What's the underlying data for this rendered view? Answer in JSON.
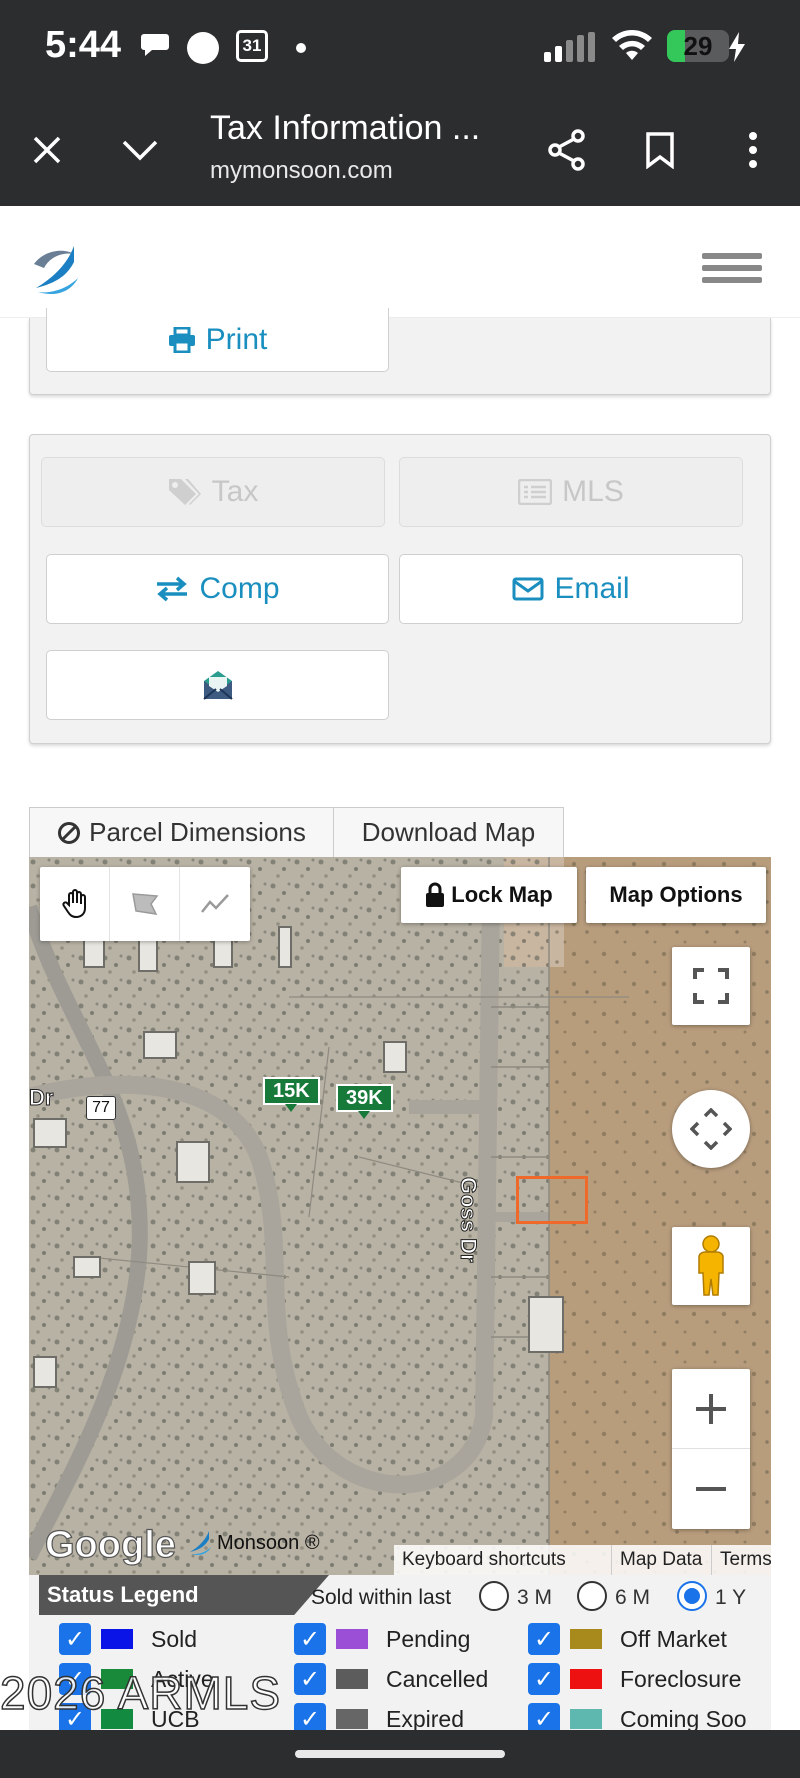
{
  "status_bar": {
    "time": "5:44",
    "calendar_day": "31",
    "battery": "29",
    "battery_level_percent": 29
  },
  "browser": {
    "title": "Tax Information ...",
    "url": "mymonsoon.com"
  },
  "print_button": {
    "label": "Print"
  },
  "actions": {
    "tax": "Tax",
    "mls": "MLS",
    "comp": "Comp",
    "email": "Email"
  },
  "map_tabs": {
    "parcel": "Parcel Dimensions",
    "download": "Download Map"
  },
  "map": {
    "lock_label": "Lock Map",
    "options_label": "Map Options",
    "road_label": "Goss Dr",
    "left_road_label": "Dr",
    "route_shield": "77",
    "prices": [
      "15K",
      "39K"
    ],
    "google_text": "Google",
    "monsoon_text": "Monsoon ®",
    "attribution": [
      "Keyboard shortcuts",
      "Map Data",
      "Terms"
    ]
  },
  "legend": {
    "title": "Status Legend",
    "sold_within": "Sold within last",
    "ranges": [
      "3 M",
      "6 M",
      "1 Y"
    ],
    "selected_range": "1 Y",
    "items": [
      {
        "label": "Sold",
        "color": "#0a14e6"
      },
      {
        "label": "Pending",
        "color": "#9a4fd6"
      },
      {
        "label": "Off Market",
        "color": "#a88a1c"
      },
      {
        "label": "Active",
        "color": "#188a3a"
      },
      {
        "label": "Cancelled",
        "color": "#5c5c5c"
      },
      {
        "label": "Foreclosure",
        "color": "#ee1111"
      },
      {
        "label": "UCB",
        "color": "#128a40"
      },
      {
        "label": "Expired",
        "color": "#666666"
      },
      {
        "label": "Coming Soo",
        "color": "#5fb8b0"
      }
    ]
  },
  "watermark": "2026 ARMLS",
  "colors": {
    "accent": "#1a8fbf",
    "chrome": "#2c2d2f"
  }
}
